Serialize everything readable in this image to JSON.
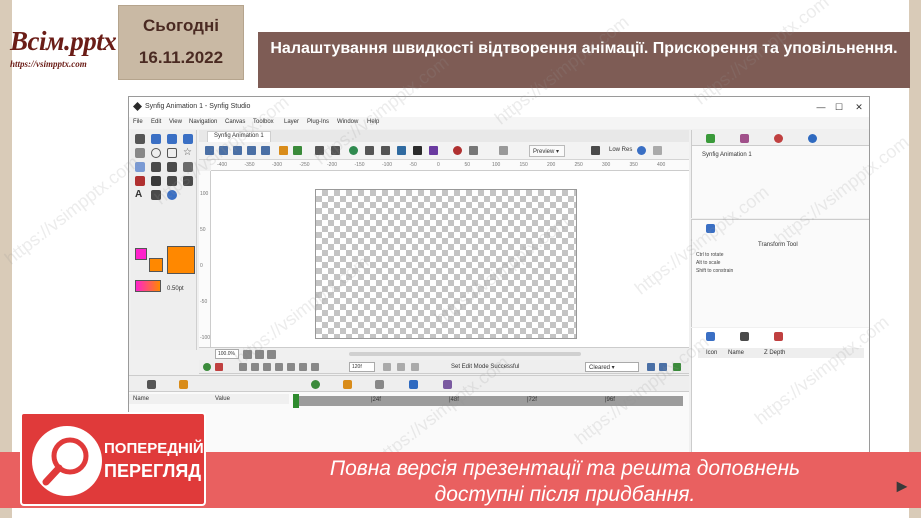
{
  "slide": {
    "logo_text": "Всім.pptx",
    "logo_url": "https://vsimpptx.com",
    "date_label": "Сьогодні",
    "date_value": "16.11.2022",
    "title": "Налаштування швидкості відтворення анімації.  Прискорення та уповільнення.",
    "watermark": "https://vsimpptx.com"
  },
  "window": {
    "title": "Synfig Animation 1 - Synfig Studio",
    "controls": [
      "—",
      "☐",
      "✕"
    ],
    "menu": [
      "File",
      "Edit",
      "View",
      "Navigation",
      "Canvas",
      "Toolbox",
      "Layer",
      "Plug-Ins",
      "Window",
      "Help"
    ]
  },
  "canvas": {
    "tab_label": "Synfig Animation 1",
    "preview_label": "Preview",
    "lowres_label": "Low Res",
    "ruler_h": [
      "-400",
      "-350",
      "-300",
      "-250",
      "-200",
      "-150",
      "-100",
      "-50",
      "0",
      "50",
      "100",
      "150",
      "200",
      "250",
      "300",
      "350",
      "400"
    ],
    "ruler_v": [
      "100",
      "50",
      "0",
      "-50",
      "-100"
    ],
    "zoom": "100.0%",
    "time": "120f",
    "status": "Set Edit Mode Successful",
    "mode_select": "Cleared"
  },
  "toolbox": {
    "brush_size": "0.50pt",
    "colors": {
      "outline": "#ff22cc",
      "fill": "#ff8800",
      "gradient_start": "#ff22cc",
      "gradient_end": "#ff8800"
    }
  },
  "right_panel": {
    "canvas_item": "Synfig Animation 1",
    "tool_title": "Transform Tool",
    "hints": [
      "Ctrl to rotate",
      "Alt to scale",
      "Shift to constrain"
    ],
    "layers_columns": [
      "Icon",
      "Name",
      "Z Depth"
    ]
  },
  "bottom_panel": {
    "params_columns": [
      "Name",
      "Value"
    ],
    "timetrack_labels": [
      "|24f",
      "|48f",
      "|72f",
      "|96f"
    ]
  },
  "banner": {
    "badge_line1": "ПОПЕРЕДНІЙ",
    "badge_line2": "ПЕРЕГЛЯД",
    "message_line1": "Повна версія презентації та решта доповнень",
    "message_line2": "доступні після придбання."
  }
}
